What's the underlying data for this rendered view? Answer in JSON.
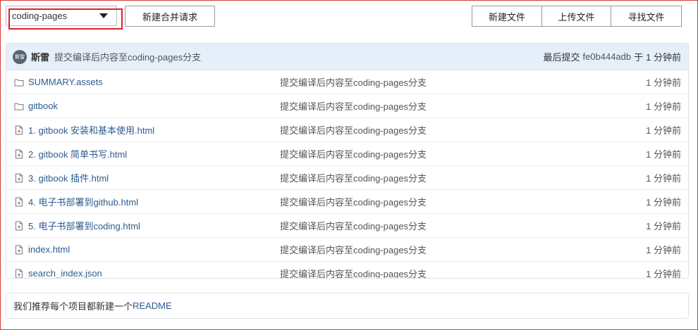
{
  "toolbar": {
    "branch": "coding-pages",
    "merge_request": "新建合并请求",
    "new_file": "新建文件",
    "upload_file": "上传文件",
    "find_file": "寻找文件"
  },
  "commit": {
    "avatar_text": "斯雷",
    "author": "斯雷",
    "message": "提交编译后内容至coding-pages分支",
    "last_commit_label": "最后提交",
    "sha": "fe0b444adb",
    "at_label": "于",
    "time": "1 分钟前"
  },
  "files": [
    {
      "type": "folder",
      "name": "SUMMARY.assets",
      "message": "提交编译后内容至coding-pages分支",
      "time": "1 分钟前"
    },
    {
      "type": "folder",
      "name": "gitbook",
      "message": "提交编译后内容至coding-pages分支",
      "time": "1 分钟前"
    },
    {
      "type": "file",
      "name": "1. gitbook 安装和基本使用.html",
      "message": "提交编译后内容至coding-pages分支",
      "time": "1 分钟前"
    },
    {
      "type": "file",
      "name": "2. gitbook 简单书写.html",
      "message": "提交编译后内容至coding-pages分支",
      "time": "1 分钟前"
    },
    {
      "type": "file",
      "name": "3. gitbook 插件.html",
      "message": "提交编译后内容至coding-pages分支",
      "time": "1 分钟前"
    },
    {
      "type": "file",
      "name": "4. 电子书部署到github.html",
      "message": "提交编译后内容至coding-pages分支",
      "time": "1 分钟前"
    },
    {
      "type": "file",
      "name": "5. 电子书部署到coding.html",
      "message": "提交编译后内容至coding-pages分支",
      "time": "1 分钟前"
    },
    {
      "type": "file",
      "name": "index.html",
      "message": "提交编译后内容至coding-pages分支",
      "time": "1 分钟前"
    },
    {
      "type": "file",
      "name": "search_index.json",
      "message": "提交编译后内容至coding-pages分支",
      "time": "1 分钟前"
    }
  ],
  "readme": {
    "text": "我们推荐每个项目都新建一个",
    "link": "README"
  }
}
